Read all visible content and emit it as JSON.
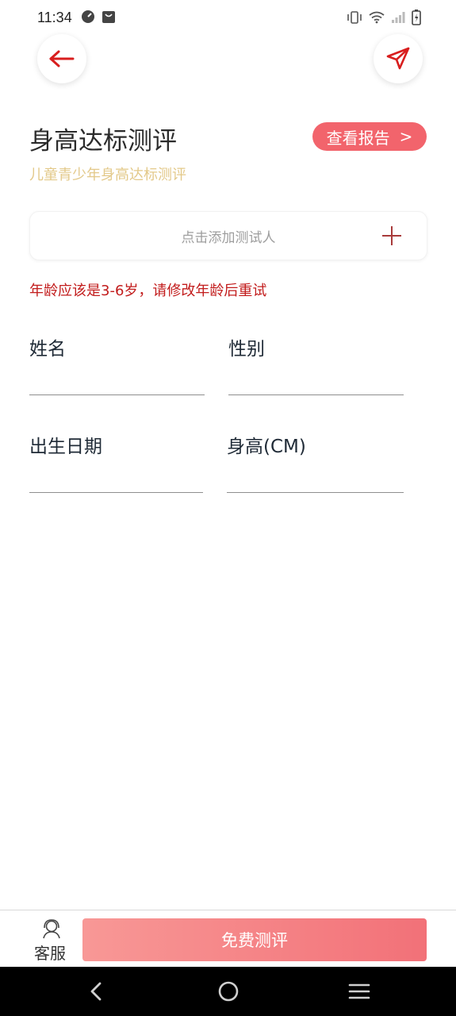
{
  "status_bar": {
    "time": "11:34"
  },
  "header": {
    "back_icon": "back-arrow-icon",
    "share_icon": "send-icon"
  },
  "title": {
    "main": "身高达标测评",
    "subtitle": "儿童青少年身高达标测评",
    "report_button": "查看报告",
    "report_chevron": ">"
  },
  "add_tester": {
    "placeholder": "点击添加测试人",
    "plus_icon": "plus-icon"
  },
  "error_message": "年龄应该是3-6岁，请修改年龄后重试",
  "form": {
    "name_label": "姓名",
    "gender_label": "性别",
    "birthdate_label": "出生日期",
    "height_label": "身高(CM)"
  },
  "bottom": {
    "service_label": "客服",
    "evaluate_button": "免费测评"
  },
  "colors": {
    "accent": "#f2646c",
    "subtitle": "#e3c98a",
    "error": "#c21c1c",
    "gradient_start": "#f89896",
    "gradient_end": "#f27178"
  }
}
